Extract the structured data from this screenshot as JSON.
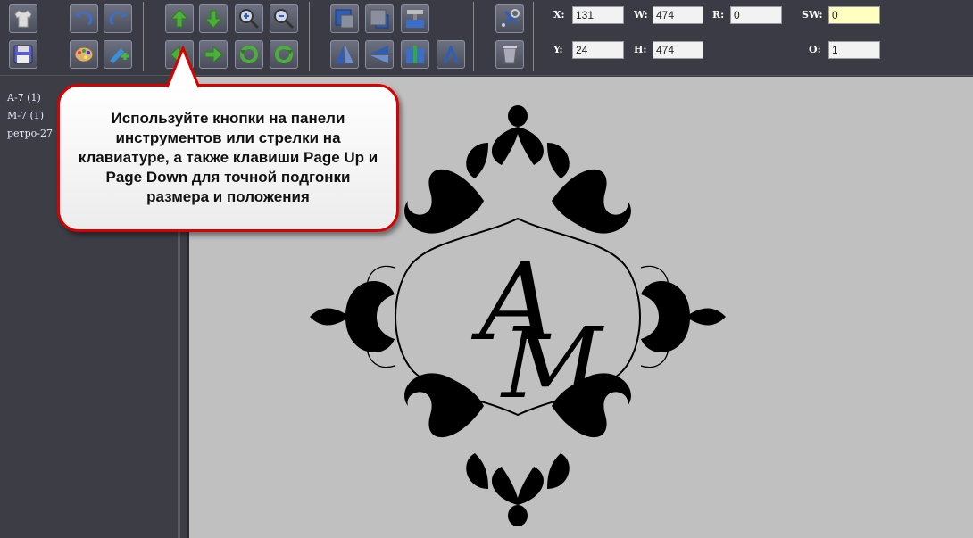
{
  "fields": {
    "x": {
      "label": "X:",
      "value": "131"
    },
    "w": {
      "label": "W:",
      "value": "474"
    },
    "r": {
      "label": "R:",
      "value": "0"
    },
    "sw": {
      "label": "SW:",
      "value": "0"
    },
    "y": {
      "label": "Y:",
      "value": "24"
    },
    "h": {
      "label": "H:",
      "value": "474"
    },
    "o": {
      "label": "O:",
      "value": "1"
    }
  },
  "sidebar": {
    "items": [
      {
        "label": "A-7 (1)"
      },
      {
        "label": "M-7 (1)"
      },
      {
        "label": "ретро-27"
      }
    ]
  },
  "tooltip": {
    "text": "Используйте кнопки на панели инструментов или стрелки на клавиатуре, а также клавиши Page Up и Page Down для точной подгонки размера и положения"
  },
  "canvas": {
    "monogram": {
      "letter1": "A",
      "letter2": "M"
    }
  },
  "colors": {
    "toolbar_bg": "#3a3b44",
    "canvas_bg": "#c0c0c0",
    "tooltip_border": "#d90000",
    "arrow_green": "#4caf3a",
    "blue_tool": "#2f5fb5",
    "highlight_field": "#ffffc0"
  },
  "icons": {
    "row1": [
      "tshirt-icon",
      "undo-icon",
      "redo-icon",
      "arrow-up-icon",
      "arrow-down-icon",
      "zoom-in-icon",
      "zoom-out-icon",
      "bring-front-icon",
      "send-back-icon",
      "align-center-icon",
      "settings-tools-icon"
    ],
    "row2": [
      "save-icon",
      "palette-icon",
      "add-image-icon",
      "arrow-left-icon",
      "arrow-right-icon",
      "rotate-left-icon",
      "rotate-right-icon",
      "flip-vertical-icon",
      "flip-horizontal-icon",
      "distribute-icon",
      "text-tool-icon",
      "trash-icon"
    ]
  }
}
